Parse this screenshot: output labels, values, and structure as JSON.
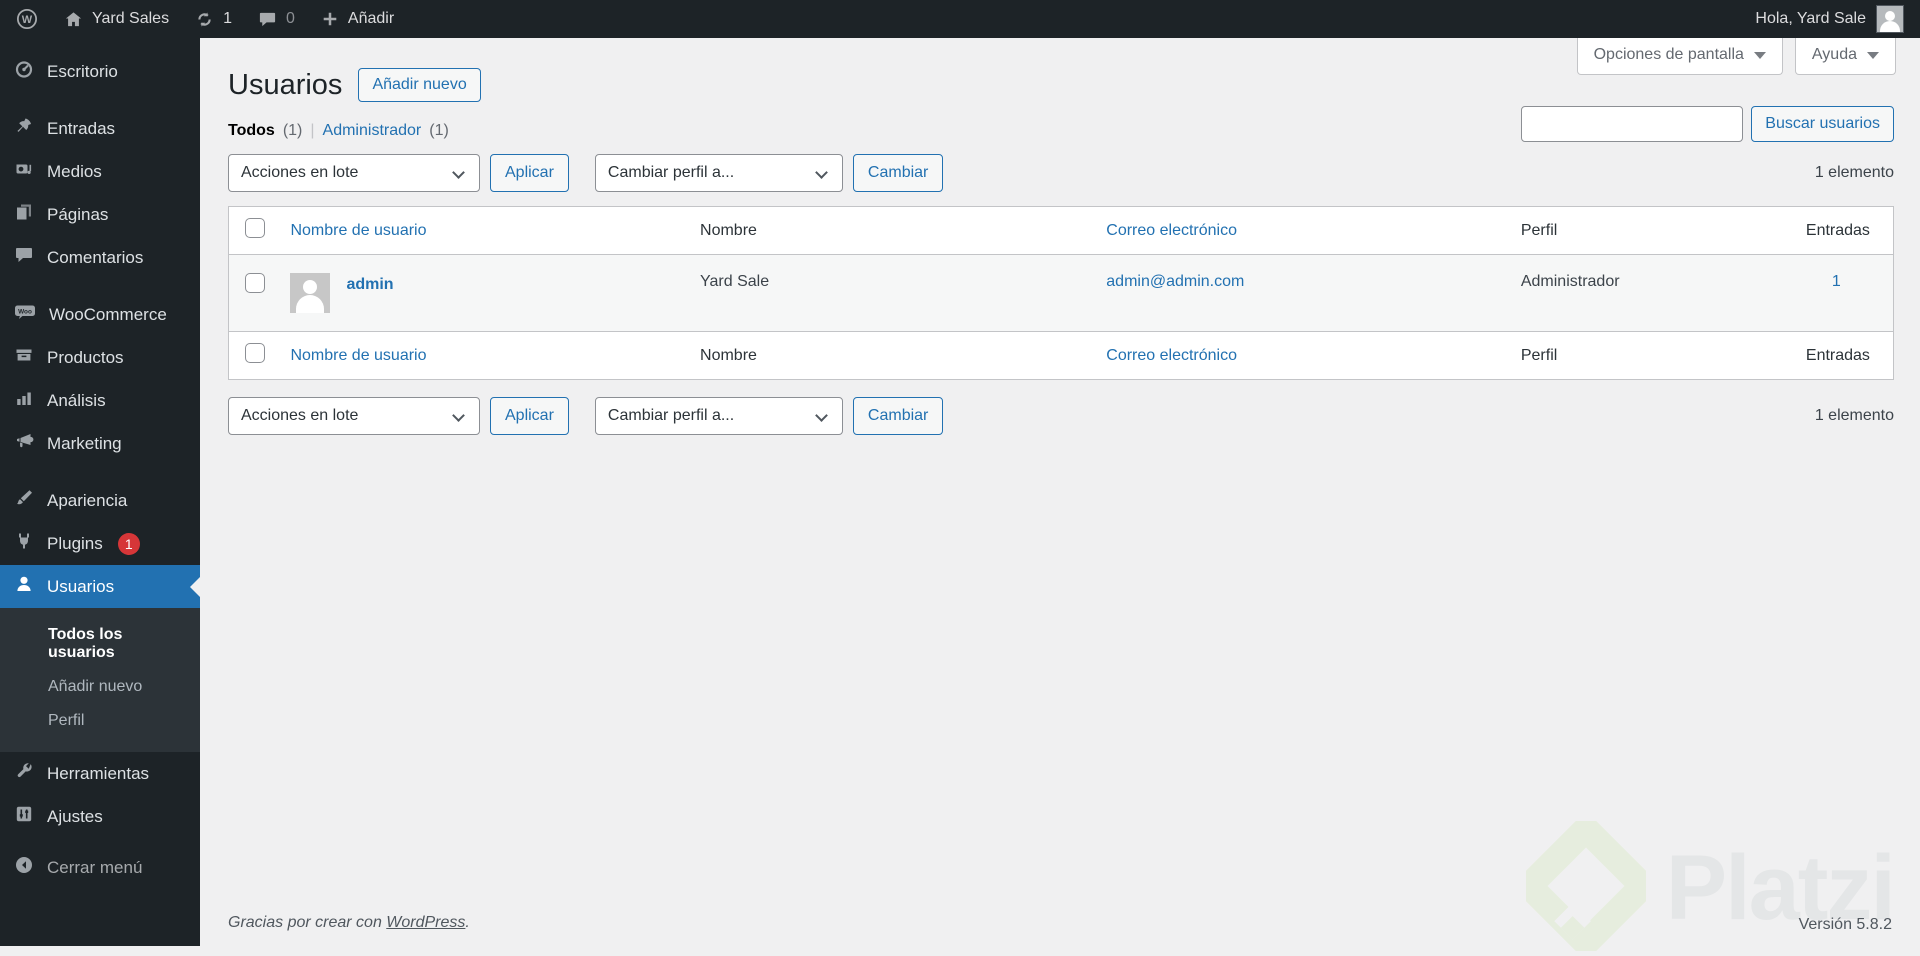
{
  "admin_bar": {
    "site_name": "Yard Sales",
    "updates_count": "1",
    "comments_count": "0",
    "new_label": "Añadir",
    "greeting": "Hola, Yard Sale"
  },
  "sidebar": {
    "items": [
      {
        "label": "Escritorio",
        "icon": "dashboard-icon"
      },
      {
        "label": "Entradas",
        "icon": "pushpin-icon"
      },
      {
        "label": "Medios",
        "icon": "media-icon"
      },
      {
        "label": "Páginas",
        "icon": "pages-icon"
      },
      {
        "label": "Comentarios",
        "icon": "comments-icon"
      },
      {
        "label": "WooCommerce",
        "icon": "woocommerce-icon"
      },
      {
        "label": "Productos",
        "icon": "products-icon"
      },
      {
        "label": "Análisis",
        "icon": "analytics-icon"
      },
      {
        "label": "Marketing",
        "icon": "marketing-icon"
      },
      {
        "label": "Apariencia",
        "icon": "appearance-icon"
      },
      {
        "label": "Plugins",
        "icon": "plugins-icon",
        "badge": "1"
      },
      {
        "label": "Usuarios",
        "icon": "users-icon",
        "active": true
      }
    ],
    "submenu": {
      "items": [
        {
          "label": "Todos los usuarios",
          "current": true
        },
        {
          "label": "Añadir nuevo"
        },
        {
          "label": "Perfil"
        }
      ]
    },
    "footer_items": [
      {
        "label": "Herramientas",
        "icon": "tools-icon"
      },
      {
        "label": "Ajustes",
        "icon": "settings-icon"
      }
    ],
    "collapse": {
      "label": "Cerrar menú",
      "icon": "collapse-icon"
    }
  },
  "screen_meta": {
    "screen_options_label": "Opciones de pantalla",
    "help_label": "Ayuda"
  },
  "content": {
    "page_title": "Usuarios",
    "add_new_button": "Añadir nuevo",
    "filters": {
      "all_label": "Todos",
      "all_count": "(1)",
      "separator": "|",
      "admin_label": "Administrador",
      "admin_count": "(1)"
    },
    "search": {
      "value": "",
      "button_label": "Buscar usuarios"
    },
    "bulk_actions": {
      "actions_select": "Acciones en lote",
      "apply_button": "Aplicar",
      "role_select": "Cambiar perfil a...",
      "change_button": "Cambiar"
    },
    "items_count": "1 elemento",
    "table": {
      "columns": {
        "username": "Nombre de usuario",
        "name": "Nombre",
        "email": "Correo electrónico",
        "role": "Perfil",
        "posts": "Entradas"
      },
      "rows": [
        {
          "username": "admin",
          "name": "Yard Sale",
          "email": "admin@admin.com",
          "role": "Administrador",
          "posts": "1"
        }
      ]
    }
  },
  "footer": {
    "thanks_prefix": "Gracias por crear con ",
    "thanks_link": "WordPress",
    "thanks_suffix": ".",
    "version": "Versión 5.8.2",
    "watermark": "Platzi"
  }
}
